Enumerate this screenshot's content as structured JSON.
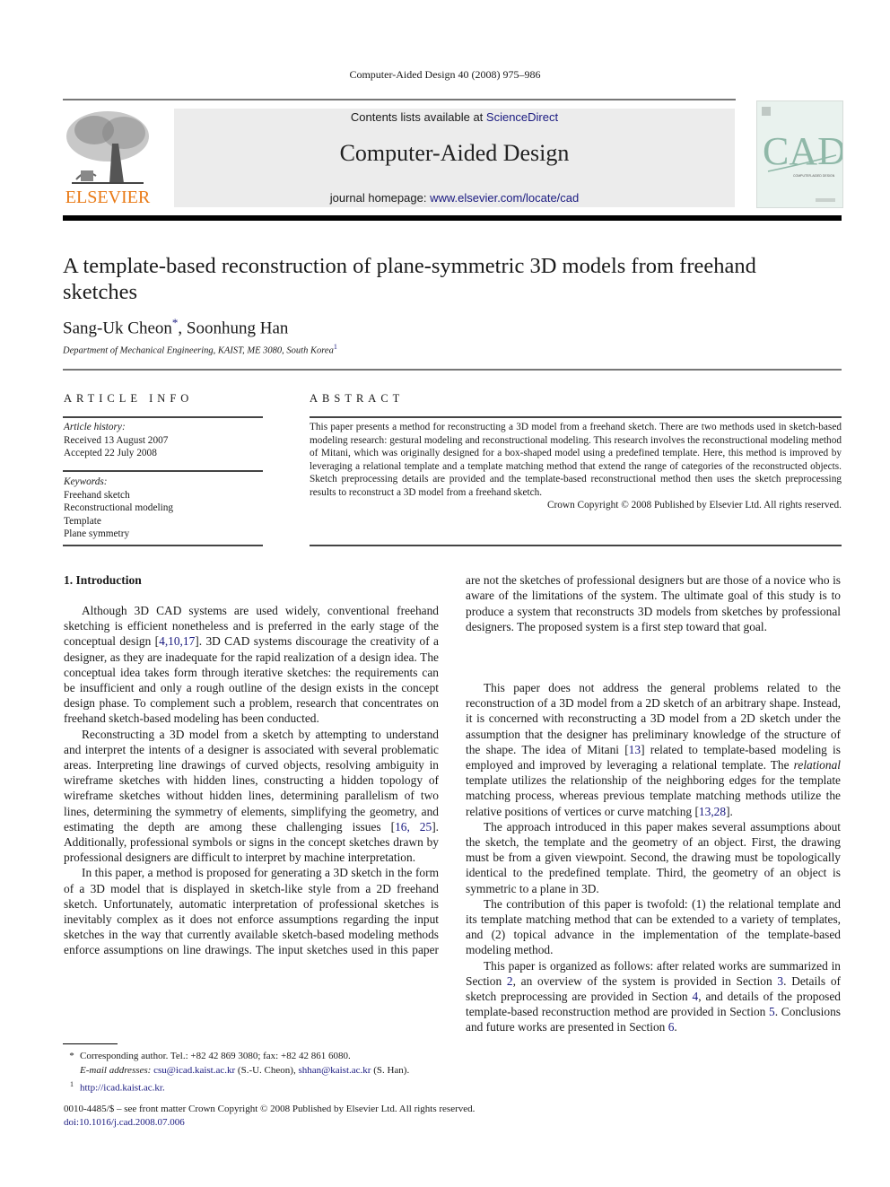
{
  "running_head": "Computer-Aided Design 40 (2008) 975–986",
  "masthead": {
    "contents_prefix": "Contents lists available at ",
    "contents_link": "ScienceDirect",
    "journal_title": "Computer-Aided Design",
    "homepage_prefix": "journal homepage: ",
    "homepage_link": "www.elsevier.com/locate/cad",
    "publisher_logo_text": "ELSEVIER",
    "cover_title": "CAD",
    "cover_subtitle": "COMPUTER-AIDED DESIGN",
    "accent_color": "#e97a16",
    "link_color": "#1a1a80"
  },
  "article": {
    "title": "A template-based reconstruction of plane-symmetric 3D models from freehand sketches",
    "authors": [
      {
        "name": "Sang-Uk Cheon",
        "mark": "*"
      },
      {
        "name": "Soonhung Han",
        "mark": ""
      }
    ],
    "author_separator": ", ",
    "affiliation": "Department of Mechanical Engineering, KAIST, ME 3080, South Korea",
    "affiliation_mark": "1"
  },
  "article_info": {
    "heading": "ARTICLE INFO",
    "history_label": "Article history:",
    "received": "Received 13 August 2007",
    "accepted": "Accepted 22 July 2008",
    "keywords_label": "Keywords:",
    "keywords": [
      "Freehand sketch",
      "Reconstructional modeling",
      "Template",
      "Plane symmetry"
    ]
  },
  "abstract": {
    "heading": "ABSTRACT",
    "text": "This paper presents a method for reconstructing a 3D model from a freehand sketch. There are two methods used in sketch-based modeling research: gestural modeling and reconstructional modeling. This research involves the reconstructional modeling method of Mitani, which was originally designed for a box-shaped model using a predefined template. Here, this method is improved by leveraging a relational template and a template matching method that extend the range of categories of the reconstructed objects. Sketch preprocessing details are provided and the template-based reconstructional method then uses the sketch preprocessing results to reconstruct a 3D model from a freehand sketch.",
    "copyright": "Crown Copyright © 2008 Published by Elsevier Ltd. All rights reserved."
  },
  "section": {
    "heading": "1.  Introduction",
    "p1": {
      "a": "Although 3D CAD systems are used widely, conventional freehand sketching is efficient nonetheless and is preferred in the early stage of the conceptual design [",
      "ref": "4,10,17",
      "b": "]. 3D CAD systems discourage the creativity of a designer, as they are inadequate for the rapid realization of a design idea. The conceptual idea takes form through iterative sketches: the requirements can be insufficient and only a rough outline of the design exists in the concept design phase. To complement such a problem, research that concentrates on freehand sketch-based modeling has been conducted."
    },
    "p2": {
      "a": "Reconstructing a 3D model from a sketch by attempting to understand and interpret the intents of a designer is associated with several problematic areas. Interpreting line drawings of curved objects, resolving ambiguity in wireframe sketches with hidden lines, constructing a hidden topology of wireframe sketches without hidden lines, determining parallelism of two lines, determining the symmetry of elements, simplifying the geometry, and estimating the depth are among these challenging issues [",
      "ref": "16, 25",
      "b": "]. Additionally, professional symbols or signs in the concept sketches drawn by professional designers are difficult to interpret by machine interpretation."
    },
    "p3": "In this paper, a method is proposed for generating a 3D sketch in the form of a 3D model that is displayed in sketch-like style from a 2D freehand sketch. Unfortunately, automatic interpretation of professional sketches is inevitably complex as it does not enforce assumptions regarding the input sketches in the way that currently available sketch-based modeling methods enforce assumptions on line drawings. The input sketches used in this paper are not the sketches of professional designers but are those of a novice who is aware of the limitations of the system. The ultimate goal of this study is to produce a system that reconstructs 3D models from sketches by professional designers. The proposed system is a first step toward that goal.",
    "p4": {
      "a": "This paper does not address the general problems related to the reconstruction of a 3D model from a 2D sketch of an arbitrary shape. Instead, it is concerned with reconstructing a 3D model from a 2D sketch under the assumption that the designer has preliminary knowledge of the structure of the shape. The idea of Mitani [",
      "ref1": "13",
      "b": "] related to template-based modeling is employed and improved by leveraging a relational template. The ",
      "em": "relational",
      "c": " template utilizes the relationship of the neighboring edges for the template matching process, whereas previous template matching methods utilize the relative positions of vertices or curve matching [",
      "ref2": "13,28",
      "d": "]."
    },
    "p5": "The approach introduced in this paper makes several assumptions about the sketch, the template and the geometry of an object. First, the drawing must be from a given viewpoint. Second, the drawing must be topologically identical to the predefined template. Third, the geometry of an object is symmetric to a plane in 3D.",
    "p6": "The contribution of this paper is twofold: (1) the relational template and its template matching method that can be extended to a variety of templates, and (2) topical advance in the implementation of the template-based modeling method.",
    "p7": {
      "a": "This paper is organized as follows: after related works are summarized in Section ",
      "s2": "2",
      "b": ", an overview of the system is provided in Section ",
      "s3": "3",
      "c": ". Details of sketch preprocessing are provided in Section ",
      "s4": "4",
      "d": ", and details of the proposed template-based reconstruction method are provided in Section ",
      "s5": "5",
      "e": ". Conclusions and future works are presented in Section ",
      "s6": "6",
      "f": "."
    }
  },
  "footnotes": {
    "star_mark": "*",
    "corresponding": "Corresponding author. Tel.: +82 42 869 3080; fax: +82 42 861 6080.",
    "email_label": "E-mail addresses:",
    "email1": "csu@icad.kaist.ac.kr",
    "email1_name": " (S.-U. Cheon), ",
    "email2": "shhan@kaist.ac.kr",
    "email2_name": " (S. Han).",
    "one_mark": "1",
    "url": "http://icad.kaist.ac.kr."
  },
  "front_matter": {
    "issn_line": "0010-4485/$ – see front matter Crown Copyright © 2008 Published by Elsevier Ltd. All rights reserved.",
    "doi": "doi:10.1016/j.cad.2008.07.006"
  }
}
